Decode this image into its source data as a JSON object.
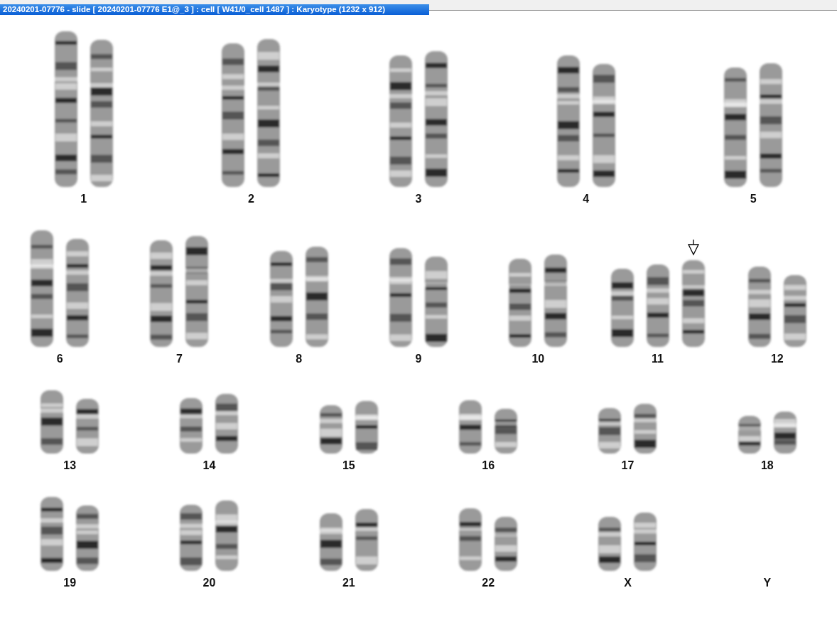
{
  "window": {
    "title": "20240201-07776 - slide [ 20240201-07776 E1@_3 ] : cell [ W41/0_cell 1487 ] : Karyotype  (1232 x 912)"
  },
  "karyotype": {
    "rows": [
      {
        "groups": [
          {
            "label": "1",
            "chromosomes": [
              {
                "marked": false
              },
              {
                "marked": false
              }
            ]
          },
          {
            "label": "2",
            "chromosomes": [
              {
                "marked": false
              },
              {
                "marked": false
              }
            ]
          },
          {
            "label": "3",
            "chromosomes": [
              {
                "marked": false
              },
              {
                "marked": false
              }
            ]
          },
          {
            "label": "4",
            "chromosomes": [
              {
                "marked": false
              },
              {
                "marked": false
              }
            ]
          },
          {
            "label": "5",
            "chromosomes": [
              {
                "marked": false
              },
              {
                "marked": false
              }
            ]
          }
        ]
      },
      {
        "groups": [
          {
            "label": "6",
            "chromosomes": [
              {
                "marked": false
              },
              {
                "marked": false
              }
            ]
          },
          {
            "label": "7",
            "chromosomes": [
              {
                "marked": false
              },
              {
                "marked": false
              }
            ]
          },
          {
            "label": "8",
            "chromosomes": [
              {
                "marked": false
              },
              {
                "marked": false
              }
            ]
          },
          {
            "label": "9",
            "chromosomes": [
              {
                "marked": false
              },
              {
                "marked": false
              }
            ]
          },
          {
            "label": "10",
            "chromosomes": [
              {
                "marked": false
              },
              {
                "marked": false
              }
            ]
          },
          {
            "label": "11",
            "chromosomes": [
              {
                "marked": false
              },
              {
                "marked": false
              },
              {
                "marked": true
              }
            ]
          },
          {
            "label": "12",
            "chromosomes": [
              {
                "marked": false
              },
              {
                "marked": false
              }
            ]
          }
        ]
      },
      {
        "groups": [
          {
            "label": "13",
            "chromosomes": [
              {
                "marked": false
              },
              {
                "marked": false
              }
            ]
          },
          {
            "label": "14",
            "chromosomes": [
              {
                "marked": false
              },
              {
                "marked": false
              }
            ]
          },
          {
            "label": "15",
            "chromosomes": [
              {
                "marked": false
              },
              {
                "marked": false
              }
            ]
          },
          {
            "label": "16",
            "chromosomes": [
              {
                "marked": false
              },
              {
                "marked": false
              }
            ]
          },
          {
            "label": "17",
            "chromosomes": [
              {
                "marked": false
              },
              {
                "marked": false
              }
            ]
          },
          {
            "label": "18",
            "chromosomes": [
              {
                "marked": false
              },
              {
                "marked": false
              }
            ]
          }
        ]
      },
      {
        "groups": [
          {
            "label": "19",
            "chromosomes": [
              {
                "marked": false
              },
              {
                "marked": false
              }
            ]
          },
          {
            "label": "20",
            "chromosomes": [
              {
                "marked": false
              },
              {
                "marked": false
              }
            ]
          },
          {
            "label": "21",
            "chromosomes": [
              {
                "marked": false
              },
              {
                "marked": false
              }
            ]
          },
          {
            "label": "22",
            "chromosomes": [
              {
                "marked": false
              },
              {
                "marked": false
              }
            ]
          },
          {
            "label": "X",
            "chromosomes": [
              {
                "marked": false
              },
              {
                "marked": false
              }
            ]
          },
          {
            "label": "Y"
          }
        ]
      }
    ]
  }
}
